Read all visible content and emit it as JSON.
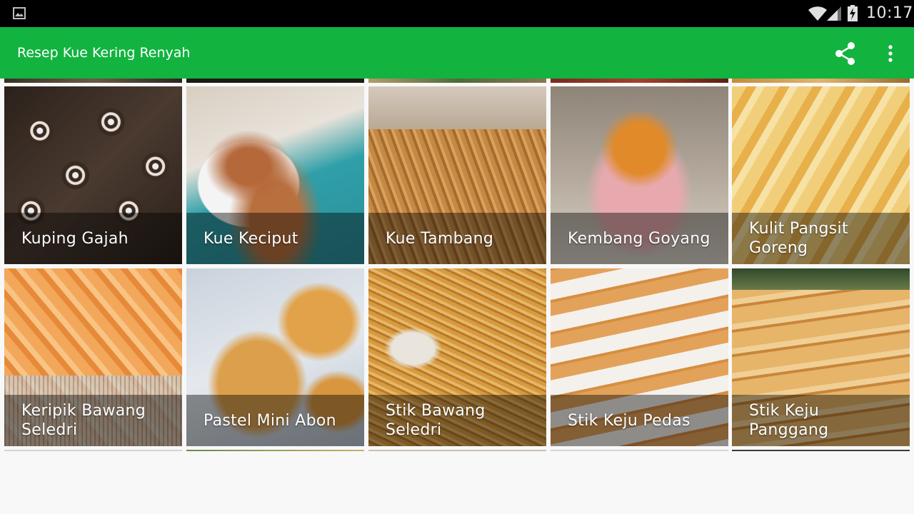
{
  "status_bar": {
    "time": "10:17",
    "icons": [
      "gallery-icon",
      "wifi-icon",
      "signal-icon",
      "battery-charging-icon"
    ]
  },
  "app_bar": {
    "title": "Resep Kue Kering Renyah",
    "actions": [
      "share-icon",
      "overflow-menu-icon"
    ]
  },
  "colors": {
    "accent": "#12b33f",
    "status_bar": "#000000",
    "background": "#f8f8f8"
  },
  "recipes": [
    {
      "title": "Kuping Gajah"
    },
    {
      "title": "Kue Keciput"
    },
    {
      "title": "Kue Tambang"
    },
    {
      "title": "Kembang Goyang"
    },
    {
      "title": "Kulit Pangsit Goreng"
    },
    {
      "title": "Keripik Bawang Seledri"
    },
    {
      "title": "Pastel Mini Abon"
    },
    {
      "title": "Stik Bawang Seledri"
    },
    {
      "title": "Stik Keju Pedas"
    },
    {
      "title": "Stik Keju Panggang"
    }
  ]
}
